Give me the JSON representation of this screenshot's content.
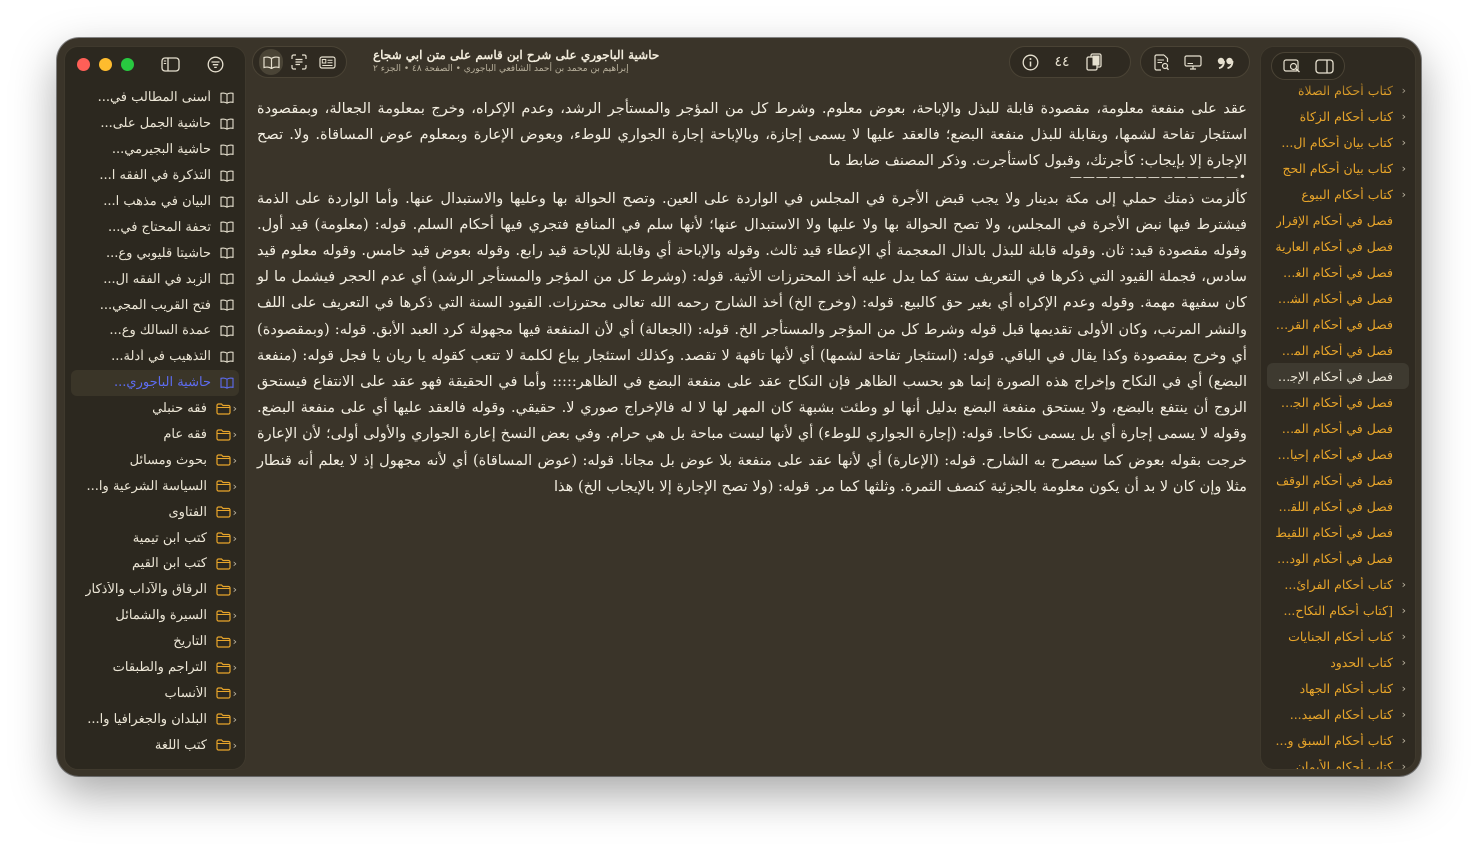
{
  "window": {
    "title": "حاشية الباجوري على شرح ابن قاسم على متن ابي شجاع",
    "subtitle": "إبراهيم بن محمد بن أحمد الشافعي الباجوري  •  الصفحة ٤٨  •  الجزء ٢"
  },
  "toolbar": {
    "page_number": "٤٤"
  },
  "library": [
    {
      "label": "أسنى المطالب في...",
      "type": "book"
    },
    {
      "label": "حاشية الجمل على...",
      "type": "book"
    },
    {
      "label": "حاشية البجيرمي...",
      "type": "book"
    },
    {
      "label": "التذكرة في الفقه ا...",
      "type": "book"
    },
    {
      "label": "البيان في مذهب ا...",
      "type": "book"
    },
    {
      "label": "تحفة المحتاج في...",
      "type": "book"
    },
    {
      "label": "حاشيتا قليوبي وع...",
      "type": "book"
    },
    {
      "label": "الزبد في الفقه ال...",
      "type": "book"
    },
    {
      "label": "فتح القريب المجي...",
      "type": "book"
    },
    {
      "label": "عمدة السالك وع...",
      "type": "book"
    },
    {
      "label": "التذهيب في أدلة...",
      "type": "book"
    },
    {
      "label": "حاشية الباجوري...",
      "type": "book",
      "selected": true
    },
    {
      "label": "فقه حنبلي",
      "type": "folder"
    },
    {
      "label": "فقه عام",
      "type": "folder"
    },
    {
      "label": "بحوث ومسائل",
      "type": "folder"
    },
    {
      "label": "السياسة الشرعية وا...",
      "type": "folder"
    },
    {
      "label": "الفتاوى",
      "type": "folder"
    },
    {
      "label": "كتب ابن تيمية",
      "type": "folder"
    },
    {
      "label": "كتب ابن القيم",
      "type": "folder"
    },
    {
      "label": "الرقاق والآداب والأذكار",
      "type": "folder"
    },
    {
      "label": "السيرة والشمائل",
      "type": "folder"
    },
    {
      "label": "التاريخ",
      "type": "folder"
    },
    {
      "label": "التراجم والطبقات",
      "type": "folder"
    },
    {
      "label": "الأنساب",
      "type": "folder"
    },
    {
      "label": "البلدان والجغرافيا وا...",
      "type": "folder"
    },
    {
      "label": "كتب اللغة",
      "type": "folder"
    }
  ],
  "toc": [
    {
      "label": "كتاب أحكام الصلاة",
      "chevron": true
    },
    {
      "label": "كتاب أحكام الزكاة",
      "chevron": true
    },
    {
      "label": "كتاب بيان أحكام ال...",
      "chevron": true
    },
    {
      "label": "كتاب بيان أحكام الحج",
      "chevron": true
    },
    {
      "label": "كتاب أحكام البيوع",
      "chevron": true
    },
    {
      "label": "فصل في أحكام الإقرار",
      "chevron": false
    },
    {
      "label": "فصل في أحكام العارية",
      "chevron": false
    },
    {
      "label": "فصل في أحكام الغصب",
      "chevron": false
    },
    {
      "label": "فصل في أحكام الشفعة",
      "chevron": false
    },
    {
      "label": "فصل في أحكام القراض",
      "chevron": false
    },
    {
      "label": "فصل في أحكام المساقاة",
      "chevron": false
    },
    {
      "label": "فصل في أحكام الإجارة",
      "chevron": false,
      "selected": true
    },
    {
      "label": "فصل في أحكام الجعالة",
      "chevron": false
    },
    {
      "label": "فصل في أحكام المخابرة",
      "chevron": false
    },
    {
      "label": "فصل في أحكام إحياء...",
      "chevron": false
    },
    {
      "label": "فصل في أحكام الوقف",
      "chevron": false
    },
    {
      "label": "فصل في أحكام اللقطة",
      "chevron": false
    },
    {
      "label": "فصل في أحكام اللقيط",
      "chevron": false
    },
    {
      "label": "فصل في أحكام الوديعة",
      "chevron": false
    },
    {
      "label": "كتاب أحكام الفرائ...",
      "chevron": true
    },
    {
      "label": "[كتاب أحكام النكاح...",
      "chevron": true
    },
    {
      "label": "كتاب أحكام الجنايات",
      "chevron": true
    },
    {
      "label": "كتاب الحدود",
      "chevron": true
    },
    {
      "label": "كتاب أحكام الجهاد",
      "chevron": true
    },
    {
      "label": "كتاب أحكام الصيد...",
      "chevron": true
    },
    {
      "label": "كتاب أحكام السبق و...",
      "chevron": true
    },
    {
      "label": "كتاب أحكام الأيمان...",
      "chevron": true
    }
  ],
  "content": {
    "matn": "عقد على منفعة معلومة، مقصودة قابلة للبذل والإباحة، بعوض معلوم. وشرط كل من المؤجر والمستأجر الرشد، وعدم الإكراه، وخرج بمعلومة الجعالة، وبمقصودة استئجار تفاحة لشمها، وبقابلة للبذل منفعة البضع؛ فالعقد عليها لا يسمى إجازة، وبالإباحة إجارة الجواري للوطء، وبعوض الإعارة وبمعلوم عوض المساقاة. ولا. تصح الإجارة إلا بإيجاب: كأجرتك، وقبول كاستأجرت. وذكر المصنف ضابط ما",
    "separator": "•—————————————",
    "sharh": "كألزمت ذمتك حملي إلى مكة بدينار ولا يجب قبض الأجرة في المجلس في الواردة على العين. وتصح الحوالة بها وعليها والاستبدال عنها. وأما الواردة على الذمة فيشترط فيها نبض الأجرة في المجلس، ولا تصح الحوالة بها ولا عليها ولا الاستبدال عنها؛ لأنها سلم في المنافع فتجري فيها أحكام السلم. قوله: (معلومة) قيد أول. وقوله مقصودة قيد: ثان. وقوله قابلة للبذل بالذال المعجمة أي الإعطاء قيد ثالث. وقوله والإباحة أي وقابلة للإباحة قيد رابع. وقوله بعوض قيد خامس. وقوله معلوم قيد سادس، فجملة القيود التي ذكرها في التعريف ستة كما يدل عليه أخذ المحترزات الأتية. قوله: (وشرط كل من المؤجر والمستأجر الرشد) أي عدم الحجر فيشمل ما لو كان سفيهة مهمة. وقوله وعدم الإكراه أي بغير حق كالبيع. قوله: (وخرج الخ) أخذ الشارح رحمه الله تعالى محترزات. القيود السنة التي ذكرها في التعريف على اللف والنشر المرتب، وكان الأولى تقديمها قبل قوله وشرط كل من المؤجر والمستأجر الخ. قوله: (الجعالة) أي لأن المنفعة فيها مجهولة كرد العبد الأبق. قوله: (وبمقصودة) أي وخرج بمقصودة وكذا يقال في الباقي. قوله: (استئجار تفاحة لشمها) أي لأنها تافهة لا تقصد. وكذلك استئجار بياع لكلمة لا تتعب كقوله يا ريان يا فجل قوله: (منفعة البضع) أي في النكاح وإخراج هذه الصورة إنما هو بحسب الظاهر فإن النكاح عقد على منفعة البضع في الظاهر::::: وأما في الحقيقة فهو عقد على الانتفاع فيستحق الزوج أن ينتفع بالبضع، ولا يستحق منفعة البضع بدليل أنها لو وطئت بشبهة كان المهر لها لا له فالإخراج صوري لا. حقيقي. وقوله فالعقد عليها أي على منفعة البضع. وقوله لا يسمى إجارة أي بل يسمى نكاحا. قوله: (إجارة الجواري للوطء) أي لأنها ليست مباحة بل هي حرام. وفي بعض النسخ إعارة الجواري والأولى أولى؛ لأن الإعارة خرجت بقوله بعوض كما سيصرح به الشارح. قوله: (الإعارة) أي لأنها عقد على منفعة بلا عوض بل مجانا. قوله: (عوض المساقاة) أي لأنه مجهول إذ لا يعلم أنه قنطار مثلا وإن كان لا بد أن يكون معلومة بالجزئية كنصف الثمرة. وثلثها كما مر. قوله: (ولا تصح الإجارة إلا بالإيجاب الخ) هذا"
  }
}
